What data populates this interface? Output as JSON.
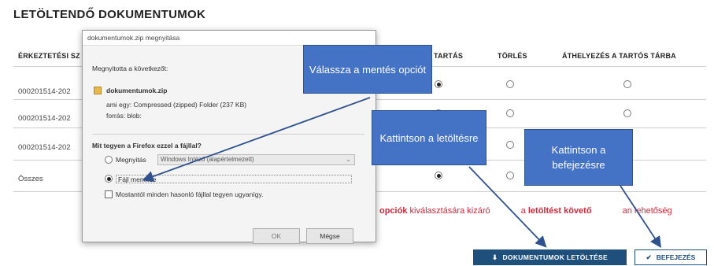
{
  "page": {
    "title": "LETÖLTENDŐ DOKUMENTUMOK"
  },
  "table": {
    "headers": [
      "ÉRKEZTETÉSI SZ",
      "TARTÁS",
      "TÖRLÉS",
      "ÁTHELYEZÉS A TARTÓS TÁRBA"
    ],
    "rows": [
      {
        "id": "000201514-202",
        "tartas": true,
        "torles": false,
        "athelyezes": false
      },
      {
        "id": "000201514-202",
        "tartas": true,
        "torles": false,
        "athelyezes": false
      },
      {
        "id": "000201514-202",
        "tartas": true,
        "torles": false,
        "athelyezes": false
      },
      {
        "id": "Összes",
        "tartas": true,
        "torles": false,
        "athelyezes": false
      }
    ]
  },
  "note": {
    "part1": "opciók",
    "part2": " kiválasztására kizáró",
    "part3": "a ",
    "part4": "letöltést követő",
    "part5": "an lehetőség"
  },
  "buttons": {
    "download": "DOKUMENTUMOK LETÖLTÉSE",
    "finish": "BEFEJEZÉS"
  },
  "dialog": {
    "title": "dokumentumok.zip megnyitása",
    "opened_label": "Megnyitotta a következőt:",
    "filename": "dokumentumok.zip",
    "type_line": "ami egy:  Compressed (zipped) Folder (237 KB)",
    "source_line": "forrás:  blob:",
    "question": "Mit tegyen a Firefox ezzel a fájllal?",
    "open_with": "Megnyitás",
    "open_with_value": "Windows Intéző (alapértelmezett)",
    "save_file": "Fájl mentése",
    "remember": "Mostantól minden hasonló fájllal tegyen ugyanígy.",
    "ok": "OK",
    "cancel": "Mégse"
  },
  "callouts": {
    "save": "Válassza  a mentés opciót",
    "download": "Kattintson a letöltésre",
    "finish": "Kattintson a befejezésre"
  },
  "colors": {
    "accent": "#1f4f7b",
    "callout": "#4472c4",
    "note_red": "#d0283c"
  }
}
